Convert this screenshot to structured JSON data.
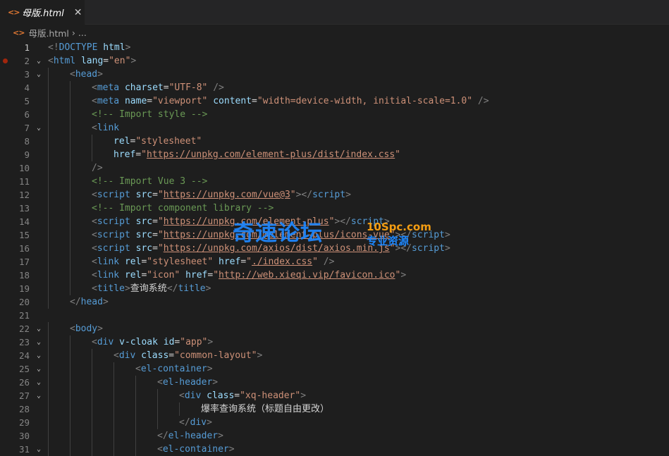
{
  "tab": {
    "icon": "<>",
    "title": "母版.html",
    "close": "✕"
  },
  "breadcrumb": {
    "icon": "<>",
    "file": "母版.html",
    "separator": "›",
    "rest": "..."
  },
  "watermark": {
    "title": "奇速论坛",
    "url": "10Spc.com",
    "subtitle": "专业资源"
  },
  "lines": [
    {
      "n": "1",
      "fold": false,
      "indent": 0,
      "tokens": [
        [
          "punc",
          "<!"
        ],
        [
          "doc",
          "DOCTYPE"
        ],
        [
          "text",
          " "
        ],
        [
          "attr",
          "html"
        ],
        [
          "punc",
          ">"
        ]
      ]
    },
    {
      "n": "2",
      "fold": true,
      "indent": 0,
      "bp": true,
      "tokens": [
        [
          "punc",
          "<"
        ],
        [
          "tag",
          "html"
        ],
        [
          "text",
          " "
        ],
        [
          "attr",
          "lang"
        ],
        [
          "text",
          "="
        ],
        [
          "val",
          "\"en\""
        ],
        [
          "punc",
          ">"
        ]
      ]
    },
    {
      "n": "3",
      "fold": true,
      "indent": 1,
      "tokens": [
        [
          "punc",
          "<"
        ],
        [
          "tag",
          "head"
        ],
        [
          "punc",
          ">"
        ]
      ]
    },
    {
      "n": "4",
      "fold": false,
      "indent": 2,
      "tokens": [
        [
          "punc",
          "<"
        ],
        [
          "tag",
          "meta"
        ],
        [
          "text",
          " "
        ],
        [
          "attr",
          "charset"
        ],
        [
          "text",
          "="
        ],
        [
          "val",
          "\"UTF-8\""
        ],
        [
          "text",
          " "
        ],
        [
          "punc",
          "/>"
        ]
      ]
    },
    {
      "n": "5",
      "fold": false,
      "indent": 2,
      "tokens": [
        [
          "punc",
          "<"
        ],
        [
          "tag",
          "meta"
        ],
        [
          "text",
          " "
        ],
        [
          "attr",
          "name"
        ],
        [
          "text",
          "="
        ],
        [
          "val",
          "\"viewport\""
        ],
        [
          "text",
          " "
        ],
        [
          "attr",
          "content"
        ],
        [
          "text",
          "="
        ],
        [
          "val",
          "\"width=device-width, initial-scale=1.0\""
        ],
        [
          "text",
          " "
        ],
        [
          "punc",
          "/>"
        ]
      ]
    },
    {
      "n": "6",
      "fold": false,
      "indent": 2,
      "tokens": [
        [
          "com",
          "<!-- Import style -->"
        ]
      ]
    },
    {
      "n": "7",
      "fold": true,
      "indent": 2,
      "tokens": [
        [
          "punc",
          "<"
        ],
        [
          "tag",
          "link"
        ]
      ]
    },
    {
      "n": "8",
      "fold": false,
      "indent": 3,
      "tokens": [
        [
          "attr",
          "rel"
        ],
        [
          "text",
          "="
        ],
        [
          "val",
          "\"stylesheet\""
        ]
      ]
    },
    {
      "n": "9",
      "fold": false,
      "indent": 3,
      "tokens": [
        [
          "attr",
          "href"
        ],
        [
          "text",
          "="
        ],
        [
          "val",
          "\""
        ],
        [
          "link",
          "https://unpkg.com/element-plus/dist/index.css"
        ],
        [
          "val",
          "\""
        ]
      ]
    },
    {
      "n": "10",
      "fold": false,
      "indent": 2,
      "tokens": [
        [
          "punc",
          "/>"
        ]
      ]
    },
    {
      "n": "11",
      "fold": false,
      "indent": 2,
      "tokens": [
        [
          "com",
          "<!-- Import Vue 3 -->"
        ]
      ]
    },
    {
      "n": "12",
      "fold": false,
      "indent": 2,
      "tokens": [
        [
          "punc",
          "<"
        ],
        [
          "tag",
          "script"
        ],
        [
          "text",
          " "
        ],
        [
          "attr",
          "src"
        ],
        [
          "text",
          "="
        ],
        [
          "val",
          "\""
        ],
        [
          "link",
          "https://unpkg.com/vue@3"
        ],
        [
          "val",
          "\""
        ],
        [
          "punc",
          "></"
        ],
        [
          "tag",
          "script"
        ],
        [
          "punc",
          ">"
        ]
      ]
    },
    {
      "n": "13",
      "fold": false,
      "indent": 2,
      "tokens": [
        [
          "com",
          "<!-- Import component library -->"
        ]
      ]
    },
    {
      "n": "14",
      "fold": false,
      "indent": 2,
      "tokens": [
        [
          "punc",
          "<"
        ],
        [
          "tag",
          "script"
        ],
        [
          "text",
          " "
        ],
        [
          "attr",
          "src"
        ],
        [
          "text",
          "="
        ],
        [
          "val",
          "\""
        ],
        [
          "link",
          "https://unpkg.com/element-plus"
        ],
        [
          "val",
          "\""
        ],
        [
          "punc",
          "></"
        ],
        [
          "tag",
          "script"
        ],
        [
          "punc",
          ">"
        ]
      ]
    },
    {
      "n": "15",
      "fold": false,
      "indent": 2,
      "tokens": [
        [
          "punc",
          "<"
        ],
        [
          "tag",
          "script"
        ],
        [
          "text",
          " "
        ],
        [
          "attr",
          "src"
        ],
        [
          "text",
          "="
        ],
        [
          "val",
          "\""
        ],
        [
          "link",
          "https://unpkg.com/@element-plus/icons-vue"
        ],
        [
          "val",
          "\""
        ],
        [
          "punc",
          "></"
        ],
        [
          "tag",
          "script"
        ],
        [
          "punc",
          ">"
        ]
      ]
    },
    {
      "n": "16",
      "fold": false,
      "indent": 2,
      "tokens": [
        [
          "punc",
          "<"
        ],
        [
          "tag",
          "script"
        ],
        [
          "text",
          " "
        ],
        [
          "attr",
          "src"
        ],
        [
          "text",
          "="
        ],
        [
          "val",
          "\""
        ],
        [
          "link",
          "https://unpkg.com/axios/dist/axios.min.js"
        ],
        [
          "val",
          "\""
        ],
        [
          "punc",
          "></"
        ],
        [
          "tag",
          "script"
        ],
        [
          "punc",
          ">"
        ]
      ]
    },
    {
      "n": "17",
      "fold": false,
      "indent": 2,
      "tokens": [
        [
          "punc",
          "<"
        ],
        [
          "tag",
          "link"
        ],
        [
          "text",
          " "
        ],
        [
          "attr",
          "rel"
        ],
        [
          "text",
          "="
        ],
        [
          "val",
          "\"stylesheet\""
        ],
        [
          "text",
          " "
        ],
        [
          "attr",
          "href"
        ],
        [
          "text",
          "="
        ],
        [
          "val",
          "\""
        ],
        [
          "link",
          "./index.css"
        ],
        [
          "val",
          "\""
        ],
        [
          "text",
          " "
        ],
        [
          "punc",
          "/>"
        ]
      ]
    },
    {
      "n": "18",
      "fold": false,
      "indent": 2,
      "tokens": [
        [
          "punc",
          "<"
        ],
        [
          "tag",
          "link"
        ],
        [
          "text",
          " "
        ],
        [
          "attr",
          "rel"
        ],
        [
          "text",
          "="
        ],
        [
          "val",
          "\"icon\""
        ],
        [
          "text",
          " "
        ],
        [
          "attr",
          "href"
        ],
        [
          "text",
          "="
        ],
        [
          "val",
          "\""
        ],
        [
          "link",
          "http://web.xieqi.vip/favicon.ico"
        ],
        [
          "val",
          "\""
        ],
        [
          "punc",
          ">"
        ]
      ]
    },
    {
      "n": "19",
      "fold": false,
      "indent": 2,
      "tokens": [
        [
          "punc",
          "<"
        ],
        [
          "tag",
          "title"
        ],
        [
          "punc",
          ">"
        ],
        [
          "text",
          "查询系统"
        ],
        [
          "punc",
          "</"
        ],
        [
          "tag",
          "title"
        ],
        [
          "punc",
          ">"
        ]
      ]
    },
    {
      "n": "20",
      "fold": false,
      "indent": 1,
      "tokens": [
        [
          "punc",
          "</"
        ],
        [
          "tag",
          "head"
        ],
        [
          "punc",
          ">"
        ]
      ]
    },
    {
      "n": "21",
      "fold": false,
      "indent": 0,
      "tokens": []
    },
    {
      "n": "22",
      "fold": true,
      "indent": 1,
      "tokens": [
        [
          "punc",
          "<"
        ],
        [
          "tag",
          "body"
        ],
        [
          "punc",
          ">"
        ]
      ]
    },
    {
      "n": "23",
      "fold": true,
      "indent": 2,
      "tokens": [
        [
          "punc",
          "<"
        ],
        [
          "tag",
          "div"
        ],
        [
          "text",
          " "
        ],
        [
          "attr",
          "v-cloak"
        ],
        [
          "text",
          " "
        ],
        [
          "attr",
          "id"
        ],
        [
          "text",
          "="
        ],
        [
          "val",
          "\"app\""
        ],
        [
          "punc",
          ">"
        ]
      ]
    },
    {
      "n": "24",
      "fold": true,
      "indent": 3,
      "tokens": [
        [
          "punc",
          "<"
        ],
        [
          "tag",
          "div"
        ],
        [
          "text",
          " "
        ],
        [
          "attr",
          "class"
        ],
        [
          "text",
          "="
        ],
        [
          "val",
          "\"common-layout\""
        ],
        [
          "punc",
          ">"
        ]
      ]
    },
    {
      "n": "25",
      "fold": true,
      "indent": 4,
      "tokens": [
        [
          "punc",
          "<"
        ],
        [
          "tag",
          "el-container"
        ],
        [
          "punc",
          ">"
        ]
      ]
    },
    {
      "n": "26",
      "fold": true,
      "indent": 5,
      "tokens": [
        [
          "punc",
          "<"
        ],
        [
          "tag",
          "el-header"
        ],
        [
          "punc",
          ">"
        ]
      ]
    },
    {
      "n": "27",
      "fold": true,
      "indent": 6,
      "tokens": [
        [
          "punc",
          "<"
        ],
        [
          "tag",
          "div"
        ],
        [
          "text",
          " "
        ],
        [
          "attr",
          "class"
        ],
        [
          "text",
          "="
        ],
        [
          "val",
          "\"xq-header\""
        ],
        [
          "punc",
          ">"
        ]
      ]
    },
    {
      "n": "28",
      "fold": false,
      "indent": 7,
      "tokens": [
        [
          "text",
          "爆率查询系统（标题自由更改）"
        ]
      ]
    },
    {
      "n": "29",
      "fold": false,
      "indent": 6,
      "tokens": [
        [
          "punc",
          "</"
        ],
        [
          "tag",
          "div"
        ],
        [
          "punc",
          ">"
        ]
      ]
    },
    {
      "n": "30",
      "fold": false,
      "indent": 5,
      "tokens": [
        [
          "punc",
          "</"
        ],
        [
          "tag",
          "el-header"
        ],
        [
          "punc",
          ">"
        ]
      ]
    },
    {
      "n": "31",
      "fold": true,
      "indent": 5,
      "tokens": [
        [
          "punc",
          "<"
        ],
        [
          "tag",
          "el-container"
        ],
        [
          "punc",
          ">"
        ]
      ]
    }
  ],
  "colors": {
    "background": "#1e1e1e",
    "tag": "#569cd6",
    "attribute": "#9cdcfe",
    "string": "#ce9178",
    "comment": "#6a9955",
    "punctuation": "#808080",
    "breakpoint": "#a1260d"
  }
}
